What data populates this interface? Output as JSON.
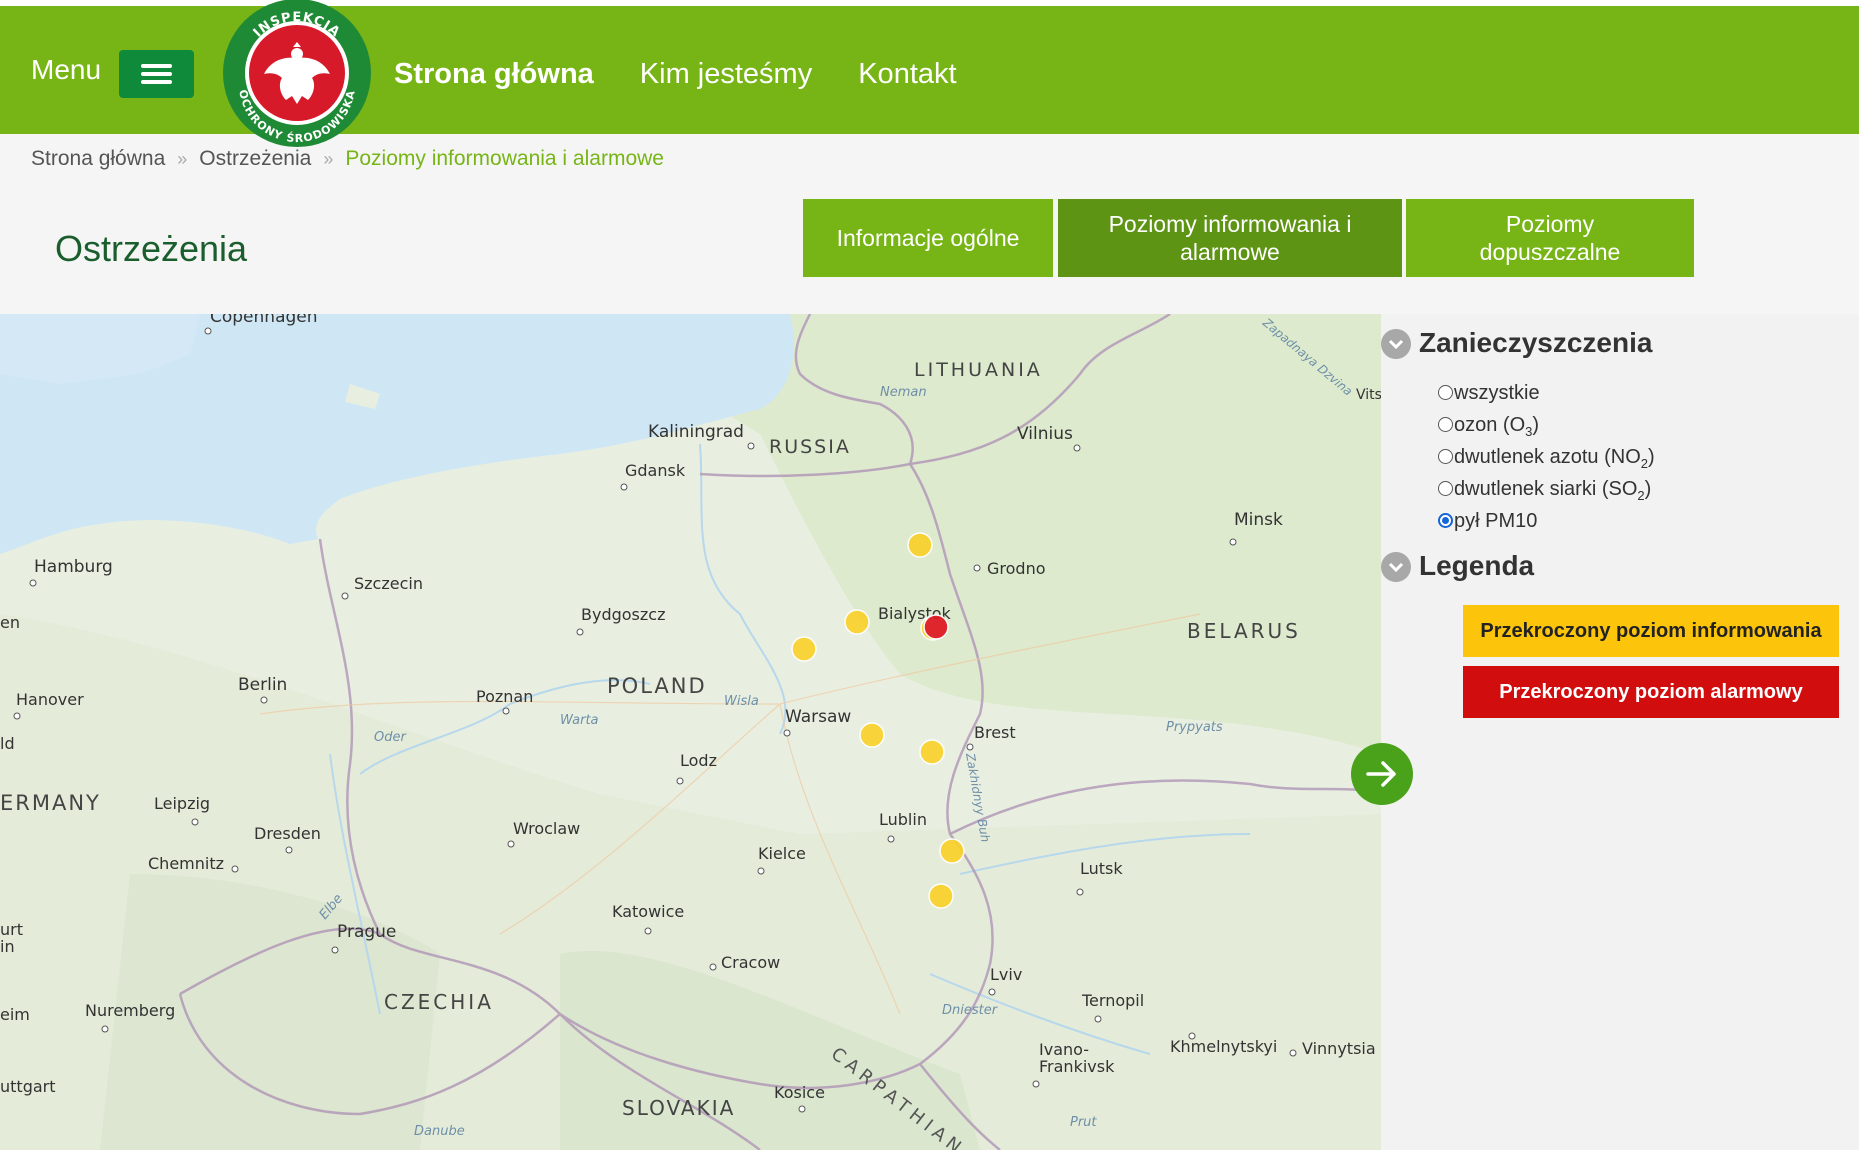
{
  "header": {
    "menu_label": "Menu",
    "logo_text_top": "INSPEKCJA",
    "logo_text_bottom": "OCHRONY ŚRODOWISKA",
    "nav": [
      {
        "label": "Strona główna",
        "active": true
      },
      {
        "label": "Kim jesteśmy",
        "active": false
      },
      {
        "label": "Kontakt",
        "active": false
      }
    ],
    "colors": {
      "bar": "#77b516",
      "button": "#0f8a3a",
      "logo_red": "#d71a2a",
      "logo_green": "#1f8a36"
    }
  },
  "breadcrumb": [
    {
      "label": "Strona główna"
    },
    {
      "label": "Ostrzeżenia"
    },
    {
      "label": "Poziomy informowania i alarmowe",
      "current": true
    }
  ],
  "page": {
    "title": "Ostrzeżenia"
  },
  "tabs": [
    {
      "label": "Informacje ogólne",
      "active": false
    },
    {
      "label": "Poziomy informowania i alarmowe",
      "active": true
    },
    {
      "label": "Poziomy dopuszczalne",
      "active": false
    }
  ],
  "map": {
    "labels": {
      "copenhagen": "Copenhagen",
      "lithuania": "LITHUANIA",
      "neman": "Neman",
      "kaliningrad": "Kaliningrad",
      "russia": "RUSSIA",
      "vilnius": "Vilnius",
      "gdansk": "Gdansk",
      "minsk": "Minsk",
      "hamburg": "Hamburg",
      "szczecin": "Szczecin",
      "grodno": "Grodno",
      "bialystok": "Bialystok",
      "bydgoszcz": "Bydgoszcz",
      "belarus": "BELARUS",
      "hanover": "Hanover",
      "berlin": "Berlin",
      "poznan": "Poznan",
      "poland": "POLAND",
      "wisla": "Wisla",
      "warsaw": "Warsaw",
      "warta": "Warta",
      "brest": "Brest",
      "pripyat": "Prypyats",
      "oder": "Oder",
      "lodz": "Lodz",
      "germany": "ERMANY",
      "leipzig": "Leipzig",
      "dresden": "Dresden",
      "wroclaw": "Wroclaw",
      "lublin": "Lublin",
      "chemnitz": "Chemnitz",
      "kielce": "Kielce",
      "lutsk": "Lutsk",
      "elbe": "Elbe",
      "prague": "Prague",
      "katowice": "Katowice",
      "cracow": "Cracow",
      "lviv": "Lviv",
      "nuremberg": "Nuremberg",
      "czechia": "CZECHIA",
      "dniester": "Dniester",
      "ternopil": "Ternopil",
      "ivano": "Ivano-",
      "frankivsk": "Frankivsk",
      "khmelnytskyi": "Khmelnytskyi",
      "vinnytsia": "Vinnytsia",
      "stuttgart": "uttgart",
      "kosice": "Kosice",
      "slovakia": "SLOVAKIA",
      "carpathian": "CARPATHIAN",
      "prut": "Prut",
      "danube": "Danube",
      "vits": "Vits",
      "dvina": "Zapadnaya Dzvina",
      "bug": "Zakhidnyy Buh",
      "en": "en",
      "urt": "urt",
      "in": "in",
      "eim": "eim",
      "id": "ld"
    }
  },
  "panel": {
    "pollutants_title": "Zanieczyszczenia",
    "options": [
      {
        "label": "wszystkie",
        "checked": false
      },
      {
        "label": "ozon (O",
        "sub": "3",
        "tail": ")",
        "checked": false
      },
      {
        "label": "dwutlenek azotu (NO",
        "sub": "2",
        "tail": ")",
        "checked": false
      },
      {
        "label": "dwutlenek siarki (SO",
        "sub": "2",
        "tail": ")",
        "checked": false
      },
      {
        "label": "pył PM10",
        "checked": true
      }
    ],
    "legend_title": "Legenda",
    "legend": [
      {
        "label": "Przekroczony poziom informowania",
        "color": "#fcc50b",
        "text_color": "#222222"
      },
      {
        "label": "Przekroczony poziom alarmowy",
        "color": "#d10d0d",
        "text_color": "#ffffff"
      }
    ]
  }
}
